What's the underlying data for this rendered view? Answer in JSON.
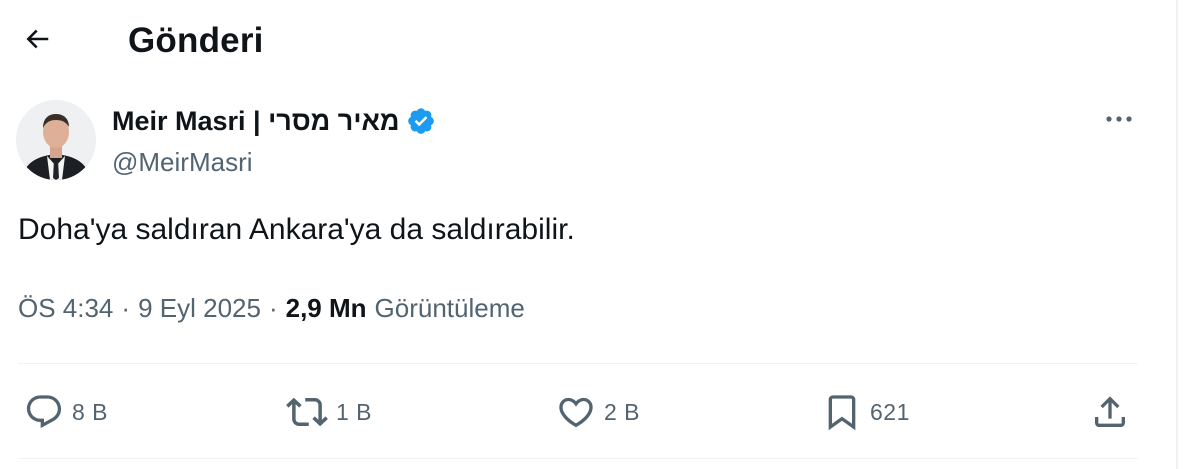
{
  "header": {
    "back_icon": "arrow-left-icon",
    "title": "Gönderi"
  },
  "author": {
    "display_name": "Meir Masri | מאיר מסרי",
    "handle": "@MeirMasri",
    "verified_icon": "verified-badge-icon",
    "verified_color": "#1d9bf0"
  },
  "more_icon": "more-horizontal-icon",
  "tweet": {
    "text": "Doha'ya saldıran Ankara'ya da saldırabilir."
  },
  "meta": {
    "time": "ÖS 4:34",
    "separator": "·",
    "date": "9 Eyl 2025",
    "views_count": "2,9 Mn",
    "views_label": "Görüntüleme"
  },
  "actions": {
    "replies": {
      "icon": "reply-icon",
      "count": "8 B"
    },
    "reposts": {
      "icon": "repost-icon",
      "count": "1 B"
    },
    "likes": {
      "icon": "heart-icon",
      "count": "2 B"
    },
    "bookmarks": {
      "icon": "bookmark-icon",
      "count": "621"
    },
    "share": {
      "icon": "share-icon"
    }
  },
  "colors": {
    "text_primary": "#0f1419",
    "text_secondary": "#536471",
    "accent": "#1d9bf0",
    "divider": "#eff3f4"
  }
}
